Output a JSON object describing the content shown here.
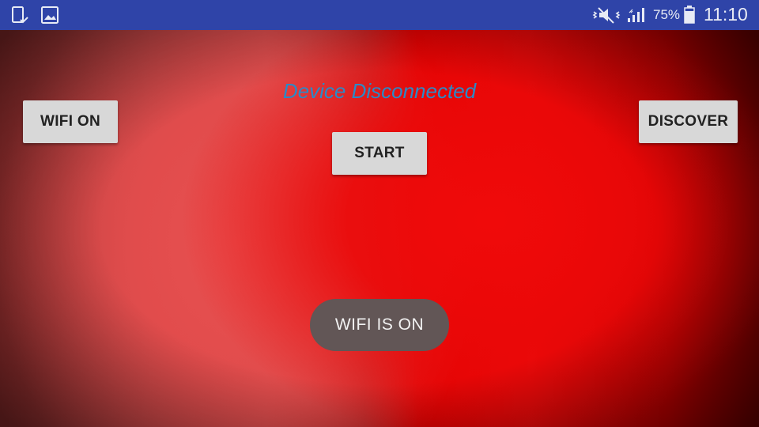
{
  "status_bar": {
    "left_icons": [
      "screen-check-icon",
      "image-icon"
    ],
    "right_icons": [
      "vibrate-mute-icon",
      "signal-icon",
      "battery-icon"
    ],
    "battery_percent": "75%",
    "time": "11:10",
    "background_color": "#2f44a8"
  },
  "main": {
    "connection_status": "Device Disconnected",
    "connection_status_color": "#2a8ac8",
    "buttons": {
      "wifi_on": "WIFI ON",
      "start": "START",
      "discover": "DISCOVER"
    },
    "toast": "WIFI IS ON"
  }
}
